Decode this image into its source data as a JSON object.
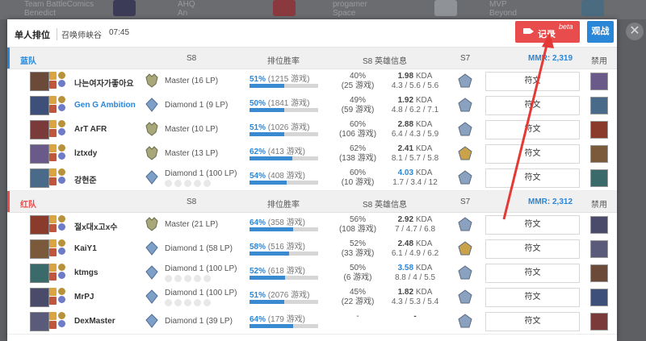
{
  "background": {
    "cards": [
      {
        "line1": "Team BattleComics",
        "line2": "Benedict"
      },
      {
        "line1": "AHQ",
        "line2": "An"
      },
      {
        "line1": "progamer",
        "line2": "Space"
      },
      {
        "line1": "MVP",
        "line2": "Beyond"
      }
    ]
  },
  "header": {
    "title": "单人排位",
    "map": "召唤师峡谷",
    "time": "07:45",
    "record_label": "记录",
    "beta_label": "beta",
    "watch_label": "观战"
  },
  "columns": {
    "season": "S8",
    "ranked_winrate": "排位胜率",
    "champ_info": "S8 英雄信息",
    "prev_season": "S7",
    "ban": "禁用"
  },
  "blue_team": {
    "name": "蓝队",
    "mmr": "MMR: 2,319",
    "players": [
      {
        "name": "나는여자가좋아요",
        "rank": "Master (16 LP)",
        "wr_pct": "51%",
        "wr_games": "(1215 游戏)",
        "wr_value": 51,
        "champ_wr": "40%",
        "champ_games": "(25 游戏)",
        "kda": "1.98",
        "kda_detail": "4.3 / 5.6 / 5.6",
        "rune": "符文"
      },
      {
        "name": "Gen G Ambition",
        "rank": "Diamond 1 (9 LP)",
        "wr_pct": "50%",
        "wr_games": "(1841 游戏)",
        "wr_value": 50,
        "champ_wr": "49%",
        "champ_games": "(59 游戏)",
        "kda": "1.92",
        "kda_detail": "4.8 / 6.2 / 7.1",
        "rune": "符文"
      },
      {
        "name": "ArT AFR",
        "rank": "Master (10 LP)",
        "wr_pct": "51%",
        "wr_games": "(1026 游戏)",
        "wr_value": 51,
        "champ_wr": "60%",
        "champ_games": "(106 游戏)",
        "kda": "2.88",
        "kda_detail": "6.4 / 4.3 / 5.9",
        "rune": "符文"
      },
      {
        "name": "lztxdy",
        "rank": "Master (13 LP)",
        "wr_pct": "62%",
        "wr_games": "(413 游戏)",
        "wr_value": 62,
        "champ_wr": "62%",
        "champ_games": "(138 游戏)",
        "kda": "2.41",
        "kda_detail": "8.1 / 5.7 / 5.8",
        "rune": "符文"
      },
      {
        "name": "강현준",
        "rank": "Diamond 1 (100 LP)",
        "wr_pct": "54%",
        "wr_games": "(408 游戏)",
        "wr_value": 54,
        "champ_wr": "60%",
        "champ_games": "(10 游戏)",
        "kda": "4.03",
        "kda_detail": "1.7 / 3.4 / 12",
        "rune": "符文"
      }
    ]
  },
  "red_team": {
    "name": "红队",
    "mmr": "MMR: 2,312",
    "players": [
      {
        "name": "절x대x고x수",
        "rank": "Master (21 LP)",
        "wr_pct": "64%",
        "wr_games": "(358 游戏)",
        "wr_value": 64,
        "champ_wr": "56%",
        "champ_games": "(108 游戏)",
        "kda": "2.92",
        "kda_detail": "7 / 4.7 / 6.8",
        "rune": "符文"
      },
      {
        "name": "KaiY1",
        "rank": "Diamond 1 (58 LP)",
        "wr_pct": "58%",
        "wr_games": "(516 游戏)",
        "wr_value": 58,
        "champ_wr": "52%",
        "champ_games": "(33 游戏)",
        "kda": "2.48",
        "kda_detail": "6.1 / 4.9 / 6.2",
        "rune": "符文"
      },
      {
        "name": "ktmgs",
        "rank": "Diamond 1 (100 LP)",
        "wr_pct": "52%",
        "wr_games": "(618 游戏)",
        "wr_value": 52,
        "champ_wr": "50%",
        "champ_games": "(6 游戏)",
        "kda": "3.58",
        "kda_detail": "8.8 / 4 / 5.5",
        "rune": "符文"
      },
      {
        "name": "MrPJ",
        "rank": "Diamond 1 (100 LP)",
        "wr_pct": "51%",
        "wr_games": "(2076 游戏)",
        "wr_value": 51,
        "champ_wr": "45%",
        "champ_games": "(22 游戏)",
        "kda": "1.82",
        "kda_detail": "4.3 / 5.3 / 5.4",
        "rune": "符文"
      },
      {
        "name": "DexMaster",
        "rank": "Diamond 1 (39 LP)",
        "wr_pct": "64%",
        "wr_games": "(179 游戏)",
        "wr_value": 64,
        "champ_wr": "-",
        "champ_games": "",
        "kda": "-",
        "kda_detail": "",
        "rune": "符文"
      }
    ]
  },
  "colors": {
    "blue_accent": "#2a86d7",
    "red_accent": "#e84c4c",
    "record_button": "#e84c4c",
    "watch_button": "#2a86d7"
  },
  "icons": [
    "close-icon",
    "camera-icon",
    "rank-emblem-icon",
    "champion-portrait",
    "summoner-spell-icon",
    "rune-icon"
  ]
}
